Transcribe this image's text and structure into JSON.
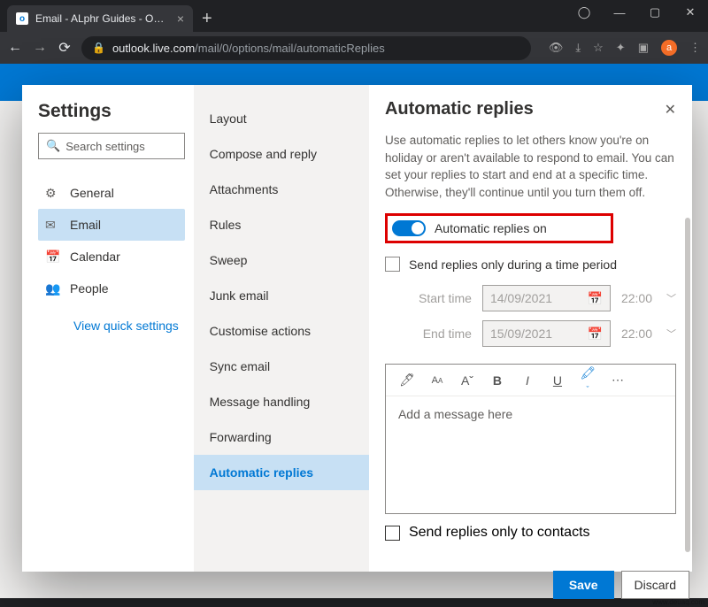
{
  "browser": {
    "tab_title": "Email - ALphr Guides - Outlook",
    "url_host": "outlook.live.com",
    "url_path": "/mail/0/options/mail/automaticReplies",
    "avatar_letter": "a"
  },
  "settings": {
    "title": "Settings",
    "search_placeholder": "Search settings",
    "categories": [
      {
        "icon": "⚙",
        "label": "General"
      },
      {
        "icon": "✉",
        "label": "Email"
      },
      {
        "icon": "📅",
        "label": "Calendar"
      },
      {
        "icon": "👥",
        "label": "People"
      }
    ],
    "quick_link": "View quick settings"
  },
  "options": {
    "items": [
      "Layout",
      "Compose and reply",
      "Attachments",
      "Rules",
      "Sweep",
      "Junk email",
      "Customise actions",
      "Sync email",
      "Message handling",
      "Forwarding",
      "Automatic replies"
    ]
  },
  "panel": {
    "title": "Automatic replies",
    "description": "Use automatic replies to let others know you're on holiday or aren't available to respond to email. You can set your replies to start and end at a specific time. Otherwise, they'll continue until you turn them off.",
    "toggle_label": "Automatic replies on",
    "period_label": "Send replies only during a time period",
    "start_label": "Start time",
    "start_date": "14/09/2021",
    "start_time": "22:00",
    "end_label": "End time",
    "end_date": "15/09/2021",
    "end_time": "22:00",
    "editor_placeholder": "Add a message here",
    "contacts_label": "Send replies only to contacts",
    "save_label": "Save",
    "discard_label": "Discard"
  }
}
